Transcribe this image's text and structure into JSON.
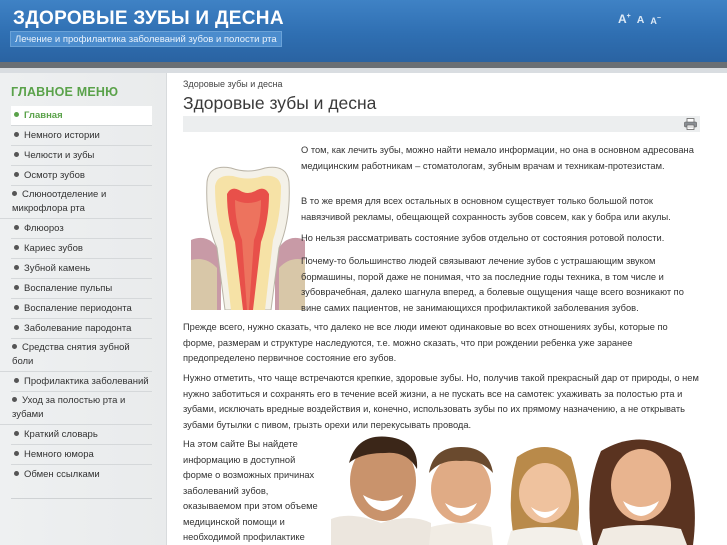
{
  "header": {
    "site_title": "ЗДОРОВЫЕ ЗУБЫ И ДЕСНА",
    "tagline": "Лечение и профилактика заболеваний зубов и полости рта",
    "font_large": "A",
    "font_normal": "A",
    "font_small": "A"
  },
  "sidebar": {
    "title": "ГЛАВНОЕ МЕНЮ",
    "items": [
      {
        "label": "Главная"
      },
      {
        "label": "Немного истории"
      },
      {
        "label": "Челюсти и зубы"
      },
      {
        "label": "Осмотр зубов"
      },
      {
        "label": "Слюноотделение и микрофлора рта"
      },
      {
        "label": "Флюороз"
      },
      {
        "label": "Кариес зубов"
      },
      {
        "label": "Зубной камень"
      },
      {
        "label": "Воспаление пульпы"
      },
      {
        "label": "Воспаление периодонта"
      },
      {
        "label": "Заболевание пародонта"
      },
      {
        "label": "Средства снятия зубной боли"
      },
      {
        "label": "Профилактика заболеваний"
      },
      {
        "label": "Уход за полостью рта и зубами"
      },
      {
        "label": "Краткий словарь"
      },
      {
        "label": "Немного юмора"
      },
      {
        "label": "Обмен ссылками"
      }
    ]
  },
  "main": {
    "breadcrumb": "Здоровые зубы и десна",
    "title": "Здоровые зубы и десна",
    "paragraphs": [
      "О том, как лечить зубы, можно найти немало информации, но она в основном адресована медицинским работникам – стоматологам, зубным врачам и техникам-протезистам.",
      "В то же время для всех остальных в основном существует только большой поток навязчивой рекламы, обещающей сохранность зубов совсем, как у бобра или акулы.",
      "Но нельзя рассматривать состояние зубов отдельно от состояния ротовой полости.",
      "Почему-то большинство людей связывают лечение зубов с устрашающим звуком бормашины, порой даже не понимая, что за последние годы техника, в том числе и зубоврачебная, далеко шагнула вперед, а болевые ощущения чаще всего возникают по вине самих пациентов, не занимающихся профилактикой заболевания зубов.",
      "Прежде всего, нужно сказать, что далеко не все люди имеют одинаковые во всех отношениях зубы, которые по форме, размерам и структуре наследуются, т.е. можно сказать, что при рождении ребенка уже заранее предопределено первичное состояние его зубов.",
      "Нужно отметить, что чаще встречаются крепкие, здоровые зубы. Но, получив такой прекрасный дар от природы, о нем нужно заботиться и сохранять его в течение всей жизни, а не пускать все на самотек: ухаживать за полостью рта и зубами, исключать вредные воздействия и, конечно, использовать зубы по их прямому назначению, а не открывать зубами бутылки с пивом, грызть орехи или перекусывать провода.",
      "На этом сайте Вы найдете информацию в доступной форме о возможных причинах заболеваний зубов, оказываемом при этом объеме медицинской помощи и необходимой профилактике заболевания зубов."
    ]
  },
  "colors": {
    "header_blue": "#2f6fb2",
    "menu_title_green": "#5aa24a",
    "active_item": "#5aa24a"
  },
  "icons": [
    "print-icon",
    "tooth-illustration",
    "family-photo"
  ]
}
